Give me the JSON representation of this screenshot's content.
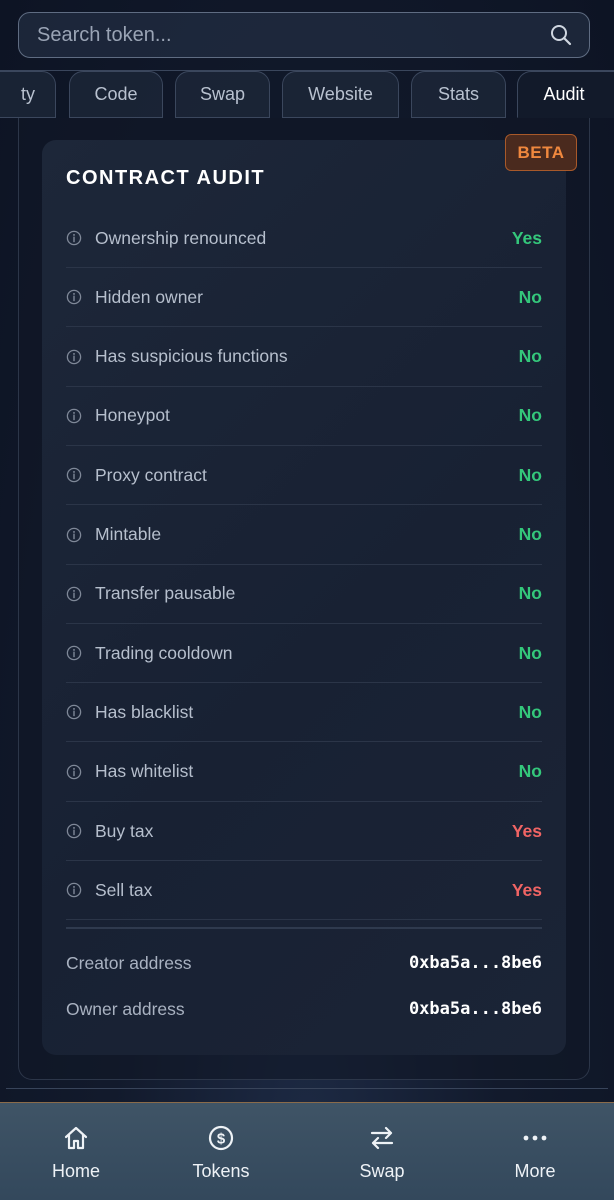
{
  "search": {
    "placeholder": "Search token..."
  },
  "tabs": [
    {
      "label": "ty"
    },
    {
      "label": "Code"
    },
    {
      "label": "Swap"
    },
    {
      "label": "Website"
    },
    {
      "label": "Stats"
    },
    {
      "label": "Audit"
    }
  ],
  "audit": {
    "badge": "BETA",
    "title": "CONTRACT AUDIT",
    "rows": [
      {
        "label": "Ownership renounced",
        "value": "Yes",
        "status": "good"
      },
      {
        "label": "Hidden owner",
        "value": "No",
        "status": "good"
      },
      {
        "label": "Has suspicious functions",
        "value": "No",
        "status": "good"
      },
      {
        "label": "Honeypot",
        "value": "No",
        "status": "good"
      },
      {
        "label": "Proxy contract",
        "value": "No",
        "status": "good"
      },
      {
        "label": "Mintable",
        "value": "No",
        "status": "good"
      },
      {
        "label": "Transfer pausable",
        "value": "No",
        "status": "good"
      },
      {
        "label": "Trading cooldown",
        "value": "No",
        "status": "good"
      },
      {
        "label": "Has blacklist",
        "value": "No",
        "status": "good"
      },
      {
        "label": "Has whitelist",
        "value": "No",
        "status": "good"
      },
      {
        "label": "Buy tax",
        "value": "Yes",
        "status": "bad"
      },
      {
        "label": "Sell tax",
        "value": "Yes",
        "status": "bad"
      }
    ],
    "creator_label": "Creator address",
    "creator_value": "0xba5a...8be6",
    "owner_label": "Owner address",
    "owner_value": "0xba5a...8be6"
  },
  "nav": [
    {
      "label": "Home",
      "icon": "home-icon"
    },
    {
      "label": "Tokens",
      "icon": "dollar-coin-icon"
    },
    {
      "label": "Swap",
      "icon": "swap-arrows-icon"
    },
    {
      "label": "More",
      "icon": "more-dots-icon"
    }
  ],
  "colors": {
    "good": "#34c77b",
    "bad": "#f06464",
    "beta": "#f0883e"
  }
}
